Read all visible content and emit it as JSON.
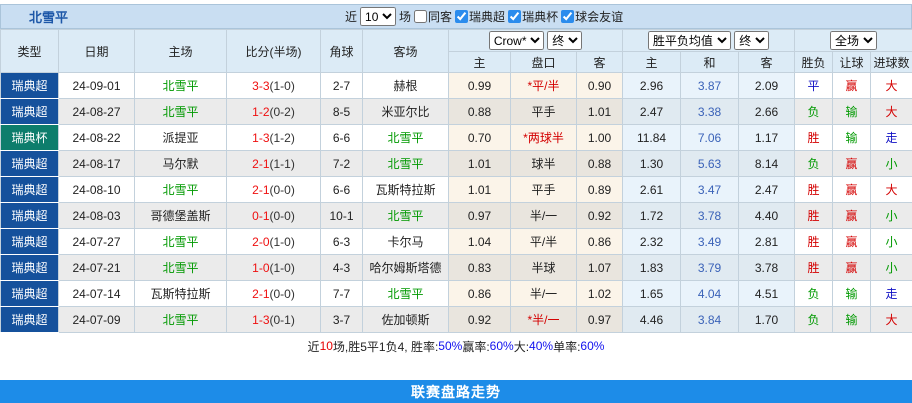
{
  "title": "北雪平",
  "toolbar": {
    "near_label": "近",
    "matches_value": "10",
    "matches_label": "场",
    "same_away_label": "同客",
    "same_away_checked": false,
    "filters": [
      {
        "label": "瑞典超",
        "checked": true
      },
      {
        "label": "瑞典杯",
        "checked": true
      },
      {
        "label": "球会友谊",
        "checked": true
      }
    ]
  },
  "header": {
    "columns": [
      "类型",
      "日期",
      "主场",
      "比分(半场)",
      "角球",
      "客场"
    ],
    "odds_group": {
      "provider_select": "Crow*",
      "stage_select": "终",
      "subcols": [
        "主",
        "盘口",
        "客"
      ]
    },
    "avg_group": {
      "type_select": "胜平负均值",
      "stage_select": "终",
      "subcols": [
        "主",
        "和",
        "客"
      ]
    },
    "result_group": {
      "scope_select": "全场",
      "subcols": [
        "胜负",
        "让球",
        "进球数"
      ]
    }
  },
  "colors": {
    "league_super_bg": "#15519c",
    "league_cup_bg": "#0d7d6c",
    "accent_blue": "#1d8ce8",
    "highlight_green": "#009900"
  },
  "rows": [
    {
      "league": "瑞典超",
      "league_bg": "#15519c",
      "date": "24-09-01",
      "home": "北雪平",
      "home_hl": true,
      "score": "3-3",
      "half": "(1-0)",
      "corners": "2-7",
      "away": "赫根",
      "away_hl": false,
      "o_home": "0.99",
      "o_hcp": "*平/半",
      "hcp_red": true,
      "o_away": "0.90",
      "a_home": "2.96",
      "a_draw": "3.87",
      "a_away": "2.09",
      "res": "平",
      "res_c": "b",
      "hcp_res": "赢",
      "hcp_res_c": "r",
      "goal": "大",
      "goal_c": "r"
    },
    {
      "league": "瑞典超",
      "league_bg": "#15519c",
      "date": "24-08-27",
      "home": "北雪平",
      "home_hl": true,
      "score": "1-2",
      "half": "(0-2)",
      "corners": "8-5",
      "away": "米亚尔比",
      "away_hl": false,
      "o_home": "0.88",
      "o_hcp": "平手",
      "hcp_red": false,
      "o_away": "1.01",
      "a_home": "2.47",
      "a_draw": "3.38",
      "a_away": "2.66",
      "res": "负",
      "res_c": "g",
      "hcp_res": "输",
      "hcp_res_c": "g",
      "goal": "大",
      "goal_c": "r"
    },
    {
      "league": "瑞典杯",
      "league_bg": "#0d7d6c",
      "date": "24-08-22",
      "home": "派提亚",
      "home_hl": false,
      "score": "1-3",
      "half": "(1-2)",
      "corners": "6-6",
      "away": "北雪平",
      "away_hl": true,
      "o_home": "0.70",
      "o_hcp": "*两球半",
      "hcp_red": true,
      "o_away": "1.00",
      "a_home": "11.84",
      "a_draw": "7.06",
      "a_away": "1.17",
      "res": "胜",
      "res_c": "r",
      "hcp_res": "输",
      "hcp_res_c": "g",
      "goal": "走",
      "goal_c": "b"
    },
    {
      "league": "瑞典超",
      "league_bg": "#15519c",
      "date": "24-08-17",
      "home": "马尔默",
      "home_hl": false,
      "score": "2-1",
      "half": "(1-1)",
      "corners": "7-2",
      "away": "北雪平",
      "away_hl": true,
      "o_home": "1.01",
      "o_hcp": "球半",
      "hcp_red": false,
      "o_away": "0.88",
      "a_home": "1.30",
      "a_draw": "5.63",
      "a_away": "8.14",
      "res": "负",
      "res_c": "g",
      "hcp_res": "赢",
      "hcp_res_c": "r",
      "goal": "小",
      "goal_c": "g"
    },
    {
      "league": "瑞典超",
      "league_bg": "#15519c",
      "date": "24-08-10",
      "home": "北雪平",
      "home_hl": true,
      "score": "2-1",
      "half": "(0-0)",
      "corners": "6-6",
      "away": "瓦斯特拉斯",
      "away_hl": false,
      "o_home": "1.01",
      "o_hcp": "平手",
      "hcp_red": false,
      "o_away": "0.89",
      "a_home": "2.61",
      "a_draw": "3.47",
      "a_away": "2.47",
      "res": "胜",
      "res_c": "r",
      "hcp_res": "赢",
      "hcp_res_c": "r",
      "goal": "大",
      "goal_c": "r"
    },
    {
      "league": "瑞典超",
      "league_bg": "#15519c",
      "date": "24-08-03",
      "home": "哥德堡盖斯",
      "home_hl": false,
      "score": "0-1",
      "half": "(0-0)",
      "corners": "10-1",
      "away": "北雪平",
      "away_hl": true,
      "o_home": "0.97",
      "o_hcp": "半/一",
      "hcp_red": false,
      "o_away": "0.92",
      "a_home": "1.72",
      "a_draw": "3.78",
      "a_away": "4.40",
      "res": "胜",
      "res_c": "r",
      "hcp_res": "赢",
      "hcp_res_c": "r",
      "goal": "小",
      "goal_c": "g"
    },
    {
      "league": "瑞典超",
      "league_bg": "#15519c",
      "date": "24-07-27",
      "home": "北雪平",
      "home_hl": true,
      "score": "2-0",
      "half": "(1-0)",
      "corners": "6-3",
      "away": "卡尔马",
      "away_hl": false,
      "o_home": "1.04",
      "o_hcp": "平/半",
      "hcp_red": false,
      "o_away": "0.86",
      "a_home": "2.32",
      "a_draw": "3.49",
      "a_away": "2.81",
      "res": "胜",
      "res_c": "r",
      "hcp_res": "赢",
      "hcp_res_c": "r",
      "goal": "小",
      "goal_c": "g"
    },
    {
      "league": "瑞典超",
      "league_bg": "#15519c",
      "date": "24-07-21",
      "home": "北雪平",
      "home_hl": true,
      "score": "1-0",
      "half": "(1-0)",
      "corners": "4-3",
      "away": "哈尔姆斯塔德",
      "away_hl": false,
      "o_home": "0.83",
      "o_hcp": "半球",
      "hcp_red": false,
      "o_away": "1.07",
      "a_home": "1.83",
      "a_draw": "3.79",
      "a_away": "3.78",
      "res": "胜",
      "res_c": "r",
      "hcp_res": "赢",
      "hcp_res_c": "r",
      "goal": "小",
      "goal_c": "g"
    },
    {
      "league": "瑞典超",
      "league_bg": "#15519c",
      "date": "24-07-14",
      "home": "瓦斯特拉斯",
      "home_hl": false,
      "score": "2-1",
      "half": "(0-0)",
      "corners": "7-7",
      "away": "北雪平",
      "away_hl": true,
      "o_home": "0.86",
      "o_hcp": "半/一",
      "hcp_red": false,
      "o_away": "1.02",
      "a_home": "1.65",
      "a_draw": "4.04",
      "a_away": "4.51",
      "res": "负",
      "res_c": "g",
      "hcp_res": "输",
      "hcp_res_c": "g",
      "goal": "走",
      "goal_c": "b"
    },
    {
      "league": "瑞典超",
      "league_bg": "#15519c",
      "date": "24-07-09",
      "home": "北雪平",
      "home_hl": true,
      "score": "1-3",
      "half": "(0-1)",
      "corners": "3-7",
      "away": "佐加顿斯",
      "away_hl": false,
      "o_home": "0.92",
      "o_hcp": "*半/一",
      "hcp_red": true,
      "o_away": "0.97",
      "a_home": "4.46",
      "a_draw": "3.84",
      "a_away": "1.70",
      "res": "负",
      "res_c": "g",
      "hcp_res": "输",
      "hcp_res_c": "g",
      "goal": "大",
      "goal_c": "r"
    }
  ],
  "summary": {
    "parts": [
      {
        "t": "近",
        "c": "k"
      },
      {
        "t": "10",
        "c": "r"
      },
      {
        "t": "场,胜5平1负4, 胜率:",
        "c": "k"
      },
      {
        "t": "50%",
        "c": "u"
      },
      {
        "t": " 赢率:",
        "c": "k"
      },
      {
        "t": "60%",
        "c": "u"
      },
      {
        "t": " 大:",
        "c": "k"
      },
      {
        "t": "40%",
        "c": "u"
      },
      {
        "t": " 单率:",
        "c": "k"
      },
      {
        "t": "60%",
        "c": "u"
      }
    ]
  },
  "footer": {
    "label": "联赛盘路走势"
  }
}
